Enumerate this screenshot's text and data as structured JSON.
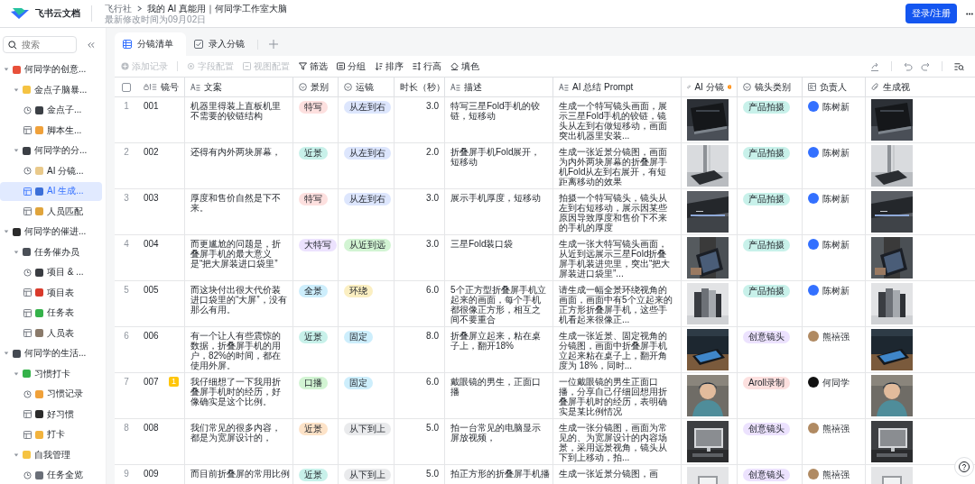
{
  "header": {
    "product": "飞书云文档",
    "breadcrumb": [
      "飞行社",
      "我的 AI 真能用｜何同学工作室大脑"
    ],
    "subtitle": "最新修改时间为09月02日",
    "login_button": "登录/注册"
  },
  "sidebar": {
    "search": {
      "placeholder": "搜索"
    },
    "items": [
      {
        "label": "何同学的创意...",
        "kind": "folder",
        "color": "#e8503a",
        "expanded": true,
        "selected": false,
        "children": [
          {
            "label": "金点子脑暴...",
            "kind": "folder",
            "color": "#f5c342",
            "expanded": true,
            "selected": false,
            "children": [
              {
                "label": "金点子...",
                "kind": "view",
                "color": "#3b3f45",
                "selected": false
              },
              {
                "label": "脚本生...",
                "kind": "table",
                "color": "#f0a13a",
                "selected": false
              }
            ]
          },
          {
            "label": "何同学的分...",
            "kind": "folder",
            "color": "#3b3f45",
            "expanded": true,
            "selected": false,
            "children": [
              {
                "label": "AI 分镜...",
                "kind": "view",
                "color": "#e9c98a",
                "selected": false
              },
              {
                "label": "AI 生成...",
                "kind": "table",
                "color": "#3c6fd8",
                "selected": true
              },
              {
                "label": "人员匹配",
                "kind": "table",
                "color": "#e0a43c",
                "selected": false
              }
            ]
          }
        ]
      },
      {
        "label": "何同学的催进...",
        "kind": "folder",
        "color": "#2b2b2b",
        "expanded": true,
        "selected": false,
        "children": [
          {
            "label": "任务催办员",
            "kind": "folder",
            "color": "#4a4f57",
            "expanded": true,
            "selected": false,
            "children": [
              {
                "label": "项目 & ...",
                "kind": "view",
                "color": "#3a3d42",
                "selected": false
              },
              {
                "label": "项目表",
                "kind": "table",
                "color": "#d93a2b",
                "selected": false
              },
              {
                "label": "任务表",
                "kind": "table",
                "color": "#35b24a",
                "selected": false
              },
              {
                "label": "人员表",
                "kind": "table",
                "color": "#8a7a6a",
                "selected": false
              }
            ]
          }
        ]
      },
      {
        "label": "何同学的生活...",
        "kind": "folder",
        "color": "#444a52",
        "expanded": true,
        "selected": false,
        "children": [
          {
            "label": "习惯打卡",
            "kind": "folder",
            "color": "#35b24a",
            "expanded": true,
            "selected": false,
            "children": [
              {
                "label": "习惯记录",
                "kind": "view",
                "color": "#f0a13a",
                "selected": false
              },
              {
                "label": "好习惯",
                "kind": "table",
                "color": "#2b2b2b",
                "selected": false
              },
              {
                "label": "打卡",
                "kind": "table",
                "color": "#f2b33d",
                "selected": false
              }
            ]
          },
          {
            "label": "自我管理",
            "kind": "folder",
            "color": "#f5c342",
            "expanded": true,
            "selected": false,
            "children": [
              {
                "label": "任务全览",
                "kind": "view",
                "color": "#6a6f78",
                "selected": false
              }
            ]
          }
        ]
      }
    ]
  },
  "tabs": [
    {
      "label": "分镜清单",
      "kind": "grid",
      "selected": true
    },
    {
      "label": "录入分镜",
      "kind": "form",
      "selected": false
    }
  ],
  "toolbar": [
    {
      "label": "添加记录",
      "kind": "add",
      "disabled": true
    },
    {
      "label": "字段配置",
      "kind": "fields",
      "disabled": true
    },
    {
      "label": "视图配置",
      "kind": "view",
      "disabled": true
    },
    {
      "label": "筛选",
      "kind": "filter",
      "disabled": false
    },
    {
      "label": "分组",
      "kind": "group",
      "disabled": false
    },
    {
      "label": "排序",
      "kind": "sort",
      "disabled": false
    },
    {
      "label": "行高",
      "kind": "height",
      "disabled": false
    },
    {
      "label": "填色",
      "kind": "fill",
      "disabled": false
    }
  ],
  "table": {
    "select_all": {
      "checked": false
    },
    "columns": [
      {
        "label": "镜号",
        "kind": "primary"
      },
      {
        "label": "文案",
        "kind": "text"
      },
      {
        "label": "景别",
        "kind": "select"
      },
      {
        "label": "运镜",
        "kind": "select"
      },
      {
        "label": "时长（秒）",
        "kind": "number"
      },
      {
        "label": "描述",
        "kind": "text"
      },
      {
        "label": "AI 总结 Prompt",
        "kind": "text"
      },
      {
        "label": "AI 分镜",
        "kind": "attachment"
      },
      {
        "label": "镜头类别",
        "kind": "select"
      },
      {
        "label": "负责人",
        "kind": "person"
      },
      {
        "label": "生成视",
        "kind": "attachment"
      }
    ],
    "rows": [
      {
        "index": "1",
        "code": "001",
        "script": "机器里得装上直板机里不需要的铰链结构",
        "shot": {
          "label": "特写",
          "color": "#fde0df"
        },
        "move": {
          "label": "从左到右",
          "color": "#dde6fd"
        },
        "duration": "3.0",
        "desc": "特写三星Fold手机的铰链，短移动",
        "prompt": "生成一个特写镜头画面，展示三星Fold手机的铰链，镜头从左到右做短移动，画面突出机器里安装...",
        "category": {
          "label": "产品拍摄",
          "color": "#c8f1ea"
        },
        "owner": {
          "name": "陈树新",
          "color": "#3370ff"
        }
      },
      {
        "index": "2",
        "code": "002",
        "script": "还得有内外两块屏幕，",
        "shot": {
          "label": "近景",
          "color": "#c8f1ea"
        },
        "move": {
          "label": "从左到右",
          "color": "#dde6fd"
        },
        "duration": "2.0",
        "desc": "折叠屏手机Fold展开，短移动",
        "prompt": "生成一张近景分镜图，画面为内外两块屏幕的折叠屏手机Fold从左到右展开，有短距离移动的效果",
        "category": {
          "label": "产品拍摄",
          "color": "#c8f1ea"
        },
        "owner": {
          "name": "陈树新",
          "color": "#3370ff"
        }
      },
      {
        "index": "3",
        "code": "003",
        "script": "厚度和售价自然是下不来。",
        "shot": {
          "label": "特写",
          "color": "#fde0df"
        },
        "move": {
          "label": "从左到右",
          "color": "#dde6fd"
        },
        "duration": "3.0",
        "desc": "展示手机厚度，短移动",
        "prompt": "拍摄一个特写镜头，镜头从左到右短移动，展示因某些原因导致厚度和售价下不来的手机的厚度",
        "category": {
          "label": "产品拍摄",
          "color": "#c8f1ea"
        },
        "owner": {
          "name": "陈树新",
          "color": "#3370ff"
        }
      },
      {
        "index": "4",
        "code": "004",
        "script": "而更尴尬的问题是，折叠屏手机的最大意义是“把大屏装进口袋里”",
        "shot": {
          "label": "大特写",
          "color": "#ece2fe"
        },
        "move": {
          "label": "从近到远",
          "color": "#d2f4d3"
        },
        "duration": "3.0",
        "desc": "三星Fold装口袋",
        "prompt": "生成一张大特写镜头画面，从近到远展示三星Fold折叠屏手机装进兜里，突出“把大屏装进口袋里”...",
        "category": {
          "label": "产品拍摄",
          "color": "#c8f1ea"
        },
        "owner": {
          "name": "陈树新",
          "color": "#3370ff"
        }
      },
      {
        "index": "5",
        "code": "005",
        "script": "而这块付出很大代价装进口袋里的“大屏”，没有那么有用。",
        "shot": {
          "label": "全景",
          "color": "#cdeefc"
        },
        "move": {
          "label": "环绕",
          "color": "#fbefc2"
        },
        "duration": "6.0",
        "desc": "5个正方型折叠屏手机立起来的画面，每个手机都很像正方形，相互之间不要重合",
        "prompt": "请生成一幅全景环绕视角的画面，画面中有5个立起来的正方形折叠屏手机，这些手机看起来很像正...",
        "category": {
          "label": "产品拍摄",
          "color": "#c8f1ea"
        },
        "owner": {
          "name": "陈树新",
          "color": "#3370ff"
        }
      },
      {
        "index": "6",
        "code": "006",
        "script": "有一个让人有些震惊的数据，折叠屏手机的用户，82%的时间，都在使用外屏。",
        "shot": {
          "label": "近景",
          "color": "#c8f1ea"
        },
        "move": {
          "label": "固定",
          "color": "#cdeefc"
        },
        "duration": "8.0",
        "desc": "折叠屏立起来，粘在桌子上，翻开18%",
        "prompt": "生成一张近景、固定视角的分镜图，画面中折叠屏手机立起来粘在桌子上，翻开角度为 18%，同时...",
        "category": {
          "label": "创意镜头",
          "color": "#ece2fe"
        },
        "owner": {
          "name": "熊禧强",
          "color": "#b08a62"
        }
      },
      {
        "index": "7",
        "code": "007",
        "badge": "1",
        "script": "我仔细想了一下我用折叠屏手机时的经历，好像确实是这个比例。",
        "shot": {
          "label": "口播",
          "color": "#d2f4d3"
        },
        "move": {
          "label": "固定",
          "color": "#cdeefc"
        },
        "duration": "6.0",
        "desc": "戴眼镜的男生，正面口播",
        "prompt": "一位戴眼镜的男生正面口播，分享自己仔细回想用折叠屏手机时的经历，表明确实是某比例情况",
        "category": {
          "label": "Aroll录制",
          "color": "#fde0df"
        },
        "owner": {
          "name": "何同学",
          "color": "#111111"
        }
      },
      {
        "index": "8",
        "code": "008",
        "script": "我们常见的很多内容，都是为宽屏设计的，",
        "shot": {
          "label": "近景",
          "color": "#fde3c8"
        },
        "move": {
          "label": "从下到上",
          "color": "#e9eaec"
        },
        "duration": "5.0",
        "desc": "拍一台常见的电脑显示屏放视频，",
        "prompt": "生成一张分镜图，画面为常见的、为宽屏设计的内容场景，采用远景视角，镜头从下到上移动，拍...",
        "category": {
          "label": "创意镜头",
          "color": "#ece2fe"
        },
        "owner": {
          "name": "熊禧强",
          "color": "#b08a62"
        }
      },
      {
        "index": "9",
        "code": "009",
        "script": "而目前折叠屏的常用比例",
        "shot": {
          "label": "近景",
          "color": "#c8f1ea"
        },
        "move": {
          "label": "从下到上",
          "color": "#e9eaec"
        },
        "duration": "5.0",
        "desc": "拍正方形的折叠屏手机播",
        "prompt": "生成一张近景分镜图，画",
        "category": {
          "label": "创意镜头",
          "color": "#ece2fe"
        },
        "owner": {
          "name": "熊禧强",
          "color": "#b08a62"
        }
      }
    ]
  }
}
